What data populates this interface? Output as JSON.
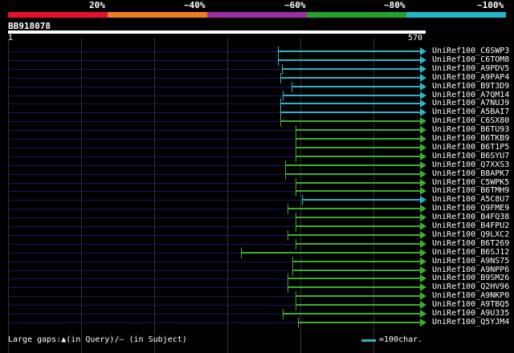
{
  "legend": [
    {
      "label": "20%",
      "color": "#e8112a"
    },
    {
      "label": "~40%",
      "color": "#f07d1e"
    },
    {
      "label": "~60%",
      "color": "#9b2ea7"
    },
    {
      "label": "~80%",
      "color": "#26a12b"
    },
    {
      "label": "~100%",
      "color": "#22b8c9"
    }
  ],
  "query": {
    "id": "BB918078",
    "start": "1",
    "end": "570"
  },
  "hits": [
    {
      "name": "UniRef100_C6SWP3",
      "color": "#29b5c9"
    },
    {
      "name": "UniRef100_C6TOM8",
      "color": "#29b5c9"
    },
    {
      "name": "UniRef100_A9PDV5",
      "color": "#29b5c9"
    },
    {
      "name": "UniRef100_A9PAP4",
      "color": "#29b5c9"
    },
    {
      "name": "UniRef100_B9T3D9",
      "color": "#29b5c9"
    },
    {
      "name": "UniRef100_A7QM14",
      "color": "#29b5c9"
    },
    {
      "name": "UniRef100_A7NUJ9",
      "color": "#29b5c9"
    },
    {
      "name": "UniRef100_A5BAI7",
      "color": "#29b5c9"
    },
    {
      "name": "UniRef100_C6SX80",
      "color": "#3ab02a"
    },
    {
      "name": "UniRef100_B6TU93",
      "color": "#3ab02a"
    },
    {
      "name": "UniRef100_B6TKB9",
      "color": "#3ab02a"
    },
    {
      "name": "UniRef100_B6T1P5",
      "color": "#3ab02a"
    },
    {
      "name": "UniRef100_B6SYU7",
      "color": "#3ab02a"
    },
    {
      "name": "UniRef100_Q7XXS3",
      "color": "#3ab02a"
    },
    {
      "name": "UniRef100_B8APK7",
      "color": "#3ab02a"
    },
    {
      "name": "UniRef100_C5WPK5",
      "color": "#3ab02a"
    },
    {
      "name": "UniRef100_B6TMH9",
      "color": "#3ab02a"
    },
    {
      "name": "UniRef100_A5C8U7",
      "color": "#29b5c9"
    },
    {
      "name": "UniRef100_Q9FME9",
      "color": "#3ab02a"
    },
    {
      "name": "UniRef100_B4FQ38",
      "color": "#3ab02a"
    },
    {
      "name": "UniRef100_B4FPU2",
      "color": "#3ab02a"
    },
    {
      "name": "UniRef100_Q9LXC2",
      "color": "#3ab02a"
    },
    {
      "name": "UniRef100_B6T269",
      "color": "#3ab02a"
    },
    {
      "name": "UniRef100_B6SJ12",
      "color": "#3ab02a"
    },
    {
      "name": "UniRef100_A9NS75",
      "color": "#3ab02a"
    },
    {
      "name": "UniRef100_A9NPP6",
      "color": "#3ab02a"
    },
    {
      "name": "UniRef100_B9SM26",
      "color": "#3ab02a"
    },
    {
      "name": "UniRef100_Q2HV96",
      "color": "#3ab02a"
    },
    {
      "name": "UniRef100_A9NKP0",
      "color": "#3ab02a"
    },
    {
      "name": "UniRef100_A9TBQ5",
      "color": "#3ab02a"
    },
    {
      "name": "UniRef100_A9U335",
      "color": "#3ab02a"
    },
    {
      "name": "UniRef100_Q5YJM4",
      "color": "#3ab02a"
    }
  ],
  "footer": {
    "gaps_text": "Large gaps:▲(in Query)/— (in Subject)",
    "scale_text": "=100char."
  }
}
